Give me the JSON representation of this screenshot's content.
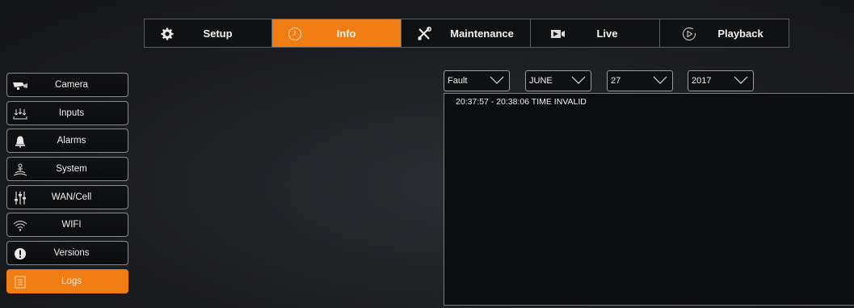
{
  "topnav": {
    "tabs": [
      {
        "label": "Setup",
        "icon": "gear-icon",
        "active": false
      },
      {
        "label": "Info",
        "icon": "info-circle-icon",
        "active": true
      },
      {
        "label": "Maintenance",
        "icon": "tools-icon",
        "active": false
      },
      {
        "label": "Live",
        "icon": "video-camera-icon",
        "active": false
      },
      {
        "label": "Playback",
        "icon": "playback-icon",
        "active": false
      }
    ]
  },
  "sidebar": {
    "items": [
      {
        "label": "Camera",
        "icon": "security-camera-icon",
        "active": false
      },
      {
        "label": "Inputs",
        "icon": "inputs-icon",
        "active": false
      },
      {
        "label": "Alarms",
        "icon": "bell-icon",
        "active": false
      },
      {
        "label": "System",
        "icon": "system-icon",
        "active": false
      },
      {
        "label": "WAN/Cell",
        "icon": "sliders-icon",
        "active": false
      },
      {
        "label": "WIFI",
        "icon": "wifi-icon",
        "active": false
      },
      {
        "label": "Versions",
        "icon": "info-badge-icon",
        "active": false
      },
      {
        "label": "Logs",
        "icon": "log-file-icon",
        "active": true
      }
    ]
  },
  "filters": {
    "type": "Fault",
    "month": "JUNE",
    "day": "27",
    "year": "2017"
  },
  "log": {
    "lines": [
      "20:37:57 - 20:38:06  TIME INVALID"
    ]
  },
  "colors": {
    "accent": "#f07d13"
  }
}
